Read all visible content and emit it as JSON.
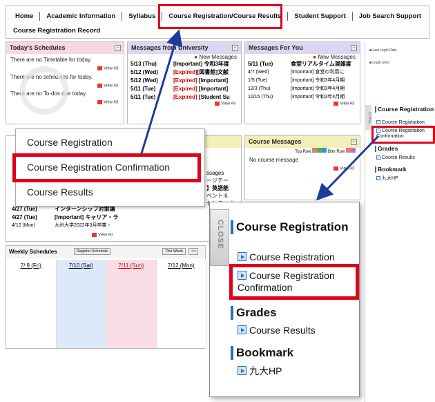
{
  "nav": {
    "items": [
      "Home",
      "Academic Information",
      "Syllabus",
      "Course Registration/Course Results",
      "Student Support",
      "Job Search Support"
    ],
    "sub": "Course Registration Record"
  },
  "today": {
    "title": "Today's Schedules",
    "lines": [
      "There are no Timetable for today.",
      "There are no schedules for today.",
      "There are no To-dos due today."
    ],
    "view_all": "View All"
  },
  "univ": {
    "title": "Messages from University",
    "new_messages": "New Messages",
    "rows": [
      {
        "date": "5/13 (Thu)",
        "tag": "[Important]",
        "text": "令和3年度"
      },
      {
        "date": "5/12 (Wed)",
        "tag": "[Expired]",
        "text": "[図書館]文献"
      },
      {
        "date": "5/12 (Wed)",
        "tag": "[Expired]",
        "text": "[Important]"
      },
      {
        "date": "5/11 (Tue)",
        "tag": "[Expired]",
        "text": "[Important]"
      },
      {
        "date": "5/11 (Tue)",
        "tag": "[Expired]",
        "text": "[Student Su"
      }
    ],
    "view_all": "View All"
  },
  "foryou": {
    "title": "Messages For You",
    "new_messages": "New Messages",
    "rows": [
      {
        "date": "5/11 (Tue)",
        "text": "食堂リアルタイム混雑度"
      },
      {
        "date": "4/7 (Wed)",
        "text": "[Important] 食堂の利用に"
      },
      {
        "date": "1/5 (Tue)",
        "text": "[Important] 令和3年4月期"
      },
      {
        "date": "12/3 (Thu)",
        "text": "[Important] 令和3年4月期"
      },
      {
        "date": "10/15 (Thu)",
        "text": "[Important] 令和3年4月期"
      }
    ],
    "view_all": "View All"
  },
  "course_messages": {
    "title": "Course Messages",
    "top_row": "Top Row",
    "btm_row": "Btm Row",
    "body": "No course message",
    "view_all": "View All"
  },
  "left_lower": {
    "rows": [
      {
        "date": "4/27 (Tue)",
        "text": "インターンシップ対策講"
      },
      {
        "date": "4/27 (Tue)",
        "text": "[Important] キャリア・ラ"
      },
      {
        "date": "4/12 (Mon)",
        "text": "九州大学2022年3月卒業・"
      }
    ],
    "fragments": [
      "ssages",
      "ージテー",
      "】英語能",
      "ベント:6",
      "センターオ"
    ],
    "view_all": "View All"
  },
  "weekly": {
    "title": "Weekly Schedules",
    "register_btn": "Register Schedule",
    "this_week_btn": "This Week",
    "prev_btn": "<<",
    "days": [
      {
        "label": "7/ 9 (Fri)",
        "bg": "#ffffff"
      },
      {
        "label": "7/10 (Sat)",
        "bg": "#dce9fb"
      },
      {
        "label": "7/11 (Sun)",
        "bg": "#fbdde6"
      },
      {
        "label": "7/12 (Mon)",
        "bg": "#ffffff"
      }
    ]
  },
  "popup": {
    "items": [
      "Course Registration",
      "Course Registration Confirmation",
      "Course Results"
    ]
  },
  "right_panel": {
    "last_login": "Last Login Date",
    "login_user": "Login User",
    "close": "CLOSE",
    "section_registration": "Course Registration",
    "item_registration": "Course Registration",
    "item_confirmation": "Course Registration Confirmation",
    "section_grades": "Grades",
    "item_results": "Course Results",
    "section_bookmark": "Bookmark",
    "item_hp": "九大HP"
  },
  "zoom": {
    "close": "CLOSE",
    "section_registration": "Course Registration",
    "item_registration": "Course Registration",
    "item_confirmation": "Course Registration Confirmation",
    "section_grades": "Grades",
    "item_results": "Course Results",
    "section_bookmark": "Bookmark",
    "item_hp": "九大HP"
  },
  "colors": {
    "highlight": "#e0001b",
    "arrow": "#1a3d9c"
  }
}
